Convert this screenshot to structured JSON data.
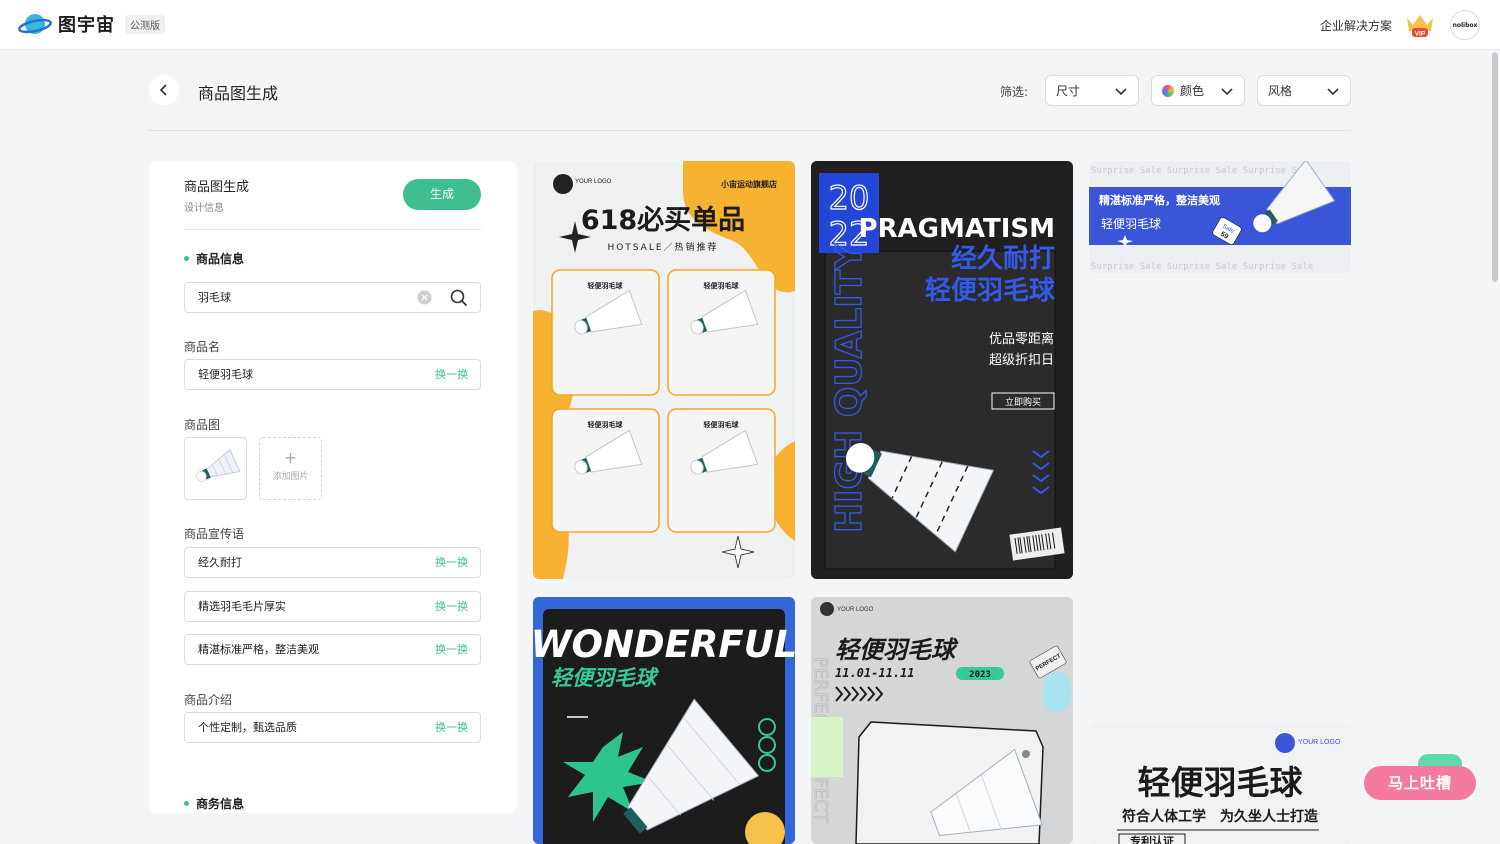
{
  "topbar": {
    "brand": "图宇宙",
    "beta_badge": "公测版",
    "enterprise_link": "企业解决方案",
    "vip_badge": "VIP",
    "avatar_text": "nolibox"
  },
  "header": {
    "title": "商品图生成",
    "filter_label": "筛选:",
    "filters": [
      {
        "label": "尺寸"
      },
      {
        "label": "颜色"
      },
      {
        "label": "风格"
      }
    ]
  },
  "panel": {
    "title": "商品图生成",
    "subtitle": "设计信息",
    "generate_button": "生成",
    "section_product": "商品信息",
    "search_value": "羽毛球",
    "product_name_label": "商品名",
    "product_name_value": "轻便羽毛球",
    "swap_label": "换一换",
    "product_image_label": "商品图",
    "add_image_label": "添加图片",
    "slogan_label": "商品宣传语",
    "slogans": [
      "经久耐打",
      "精选羽毛毛片厚实",
      "精湛标准严格，整洁美观"
    ],
    "intro_label": "商品介绍",
    "intro_value": "个性定制，甄选品质",
    "section_business": "商务信息"
  },
  "cards": {
    "c1": {
      "logo": "YOUR LOGO",
      "store": "小宙运动旗舰店",
      "headline": "618必买单品",
      "sub": "HOTSALE／热销推荐",
      "tile_label": "轻便羽毛球"
    },
    "c2": {
      "year_top": "20",
      "year_bottom": "22",
      "title": "PRAGMATISM",
      "line1": "经久耐打",
      "line2": "轻便羽毛球",
      "line3": "优品零距离",
      "line4": "超级折扣日",
      "cta": "立即购买",
      "vertical": "HIGH QUALITY"
    },
    "c3": {
      "ticker": "Surprise Sale Surprise Sale Surprise Sale",
      "slogan": "精湛标准严格，整洁美观",
      "name": "轻便羽毛球",
      "tag_top": "Sale",
      "tag_bottom": "59"
    },
    "c4": {
      "title": "WONDERFUL",
      "name": "轻便羽毛球"
    },
    "c5": {
      "logo": "YOUR LOGO",
      "name": "轻便羽毛球",
      "dates": "11.01-11.11",
      "year": "2023",
      "badge": "PERFECT",
      "vertical": "PERFECT PERFECT"
    },
    "c6": {
      "logo": "YOUR LOGO",
      "name": "轻便羽毛球",
      "desc": "符合人体工学　为久坐人士打造",
      "tag": "专利认证"
    }
  },
  "feedback_label": "马上吐槽"
}
